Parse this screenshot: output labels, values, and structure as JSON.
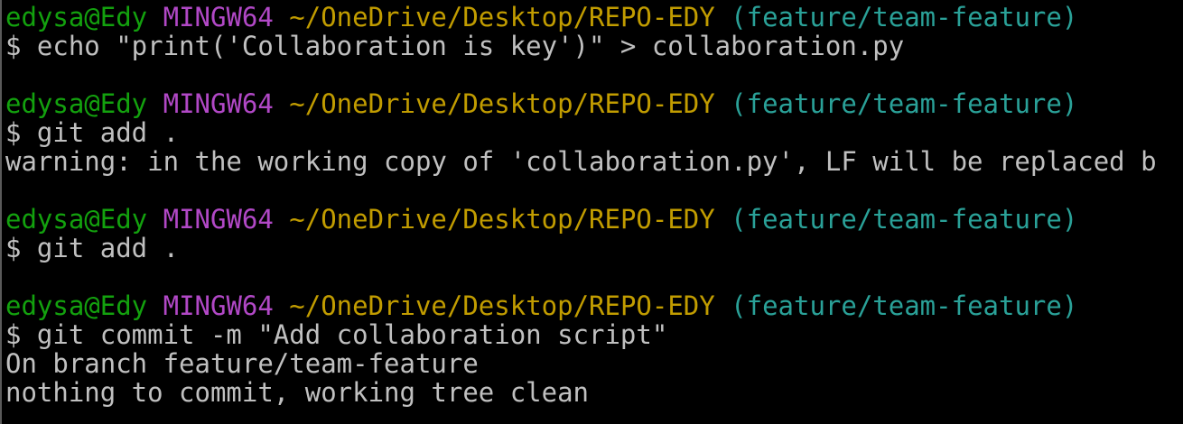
{
  "prompt": {
    "user_host": "edysa@Edy",
    "shell": "MINGW64",
    "path": "~/OneDrive/Desktop/REPO-EDY",
    "branch": "(feature/team-feature)"
  },
  "lines": {
    "cmd1": "$ echo \"print('Collaboration is key')\" > collaboration.py",
    "cmd2": "$ git add .",
    "warning": "warning: in the working copy of 'collaboration.py', LF will be replaced b",
    "cmd3": "$ git add .",
    "cmd4": "$ git commit -m \"Add collaboration script\"",
    "out1": "On branch feature/team-feature",
    "out2": "nothing to commit, working tree clean"
  },
  "colors": {
    "background": "#000000",
    "user": "#13a10e",
    "host": "#b148c6",
    "path": "#c19c00",
    "branch": "#2aa198",
    "text": "#c0c0c0"
  }
}
